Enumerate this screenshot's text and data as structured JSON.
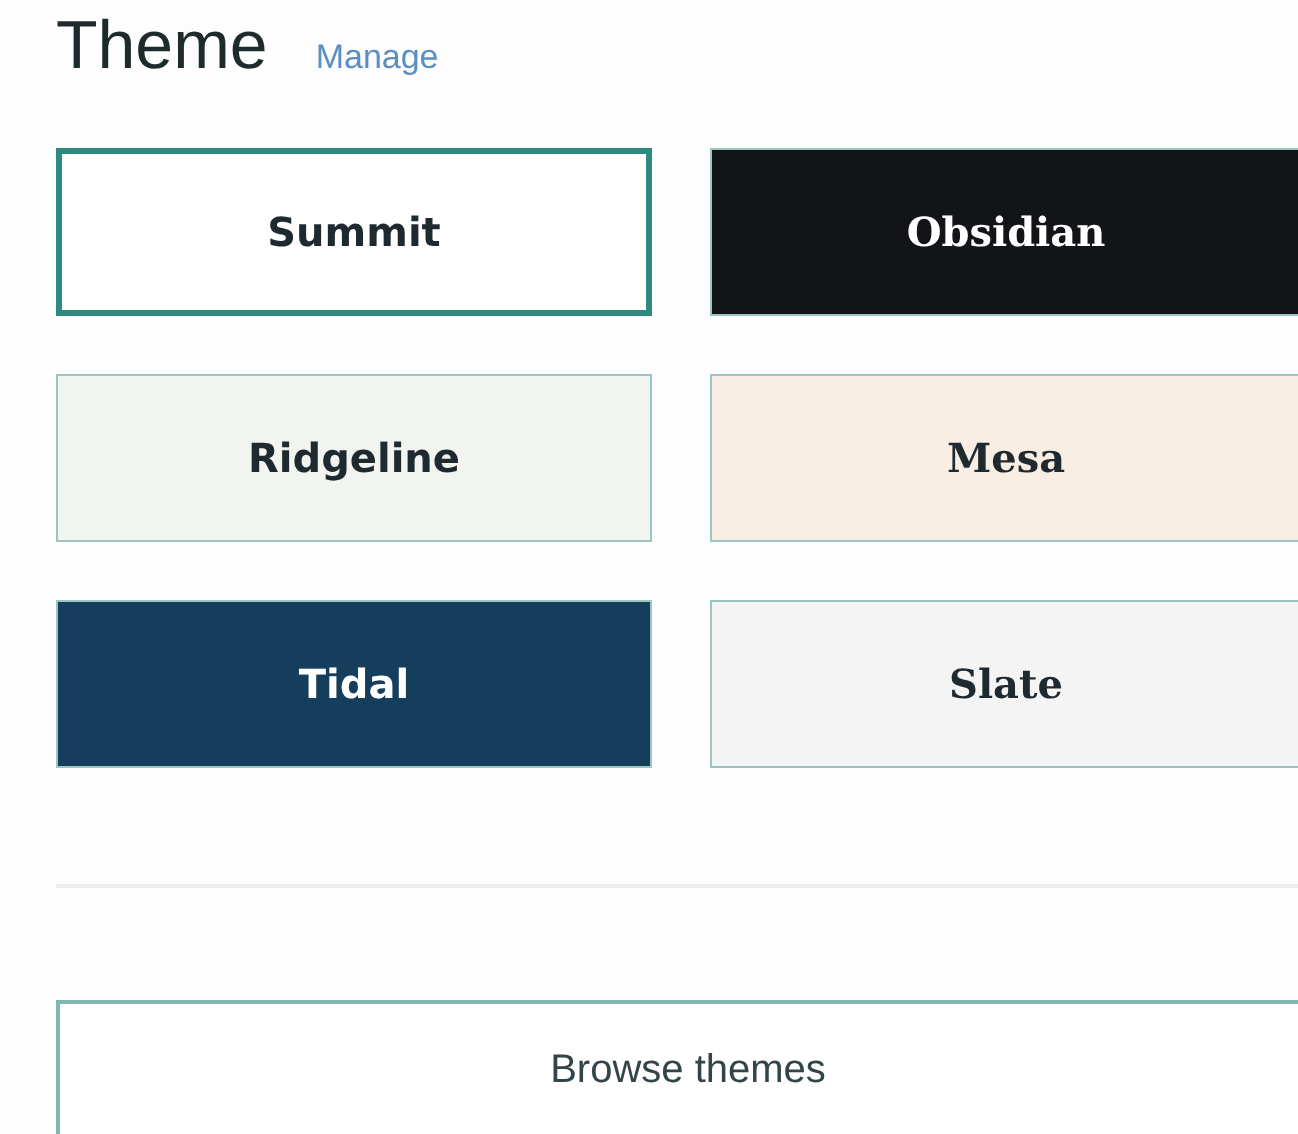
{
  "heading": "Theme",
  "manage_link": "Manage",
  "themes": [
    {
      "label": "Summit",
      "selected": true,
      "color": "#ffffff",
      "kind": "sans"
    },
    {
      "label": "Obsidian",
      "selected": false,
      "color": "#121418",
      "kind": "serif"
    },
    {
      "label": "Ridgeline",
      "selected": false,
      "color": "#f1f4ef",
      "kind": "sans"
    },
    {
      "label": "Mesa",
      "selected": false,
      "color": "#f9eee4",
      "kind": "serif"
    },
    {
      "label": "Tidal",
      "selected": false,
      "color": "#153e5c",
      "kind": "sans"
    },
    {
      "label": "Slate",
      "selected": false,
      "color": "#f4f4f4",
      "kind": "serif"
    }
  ],
  "browse_button": "Browse themes"
}
